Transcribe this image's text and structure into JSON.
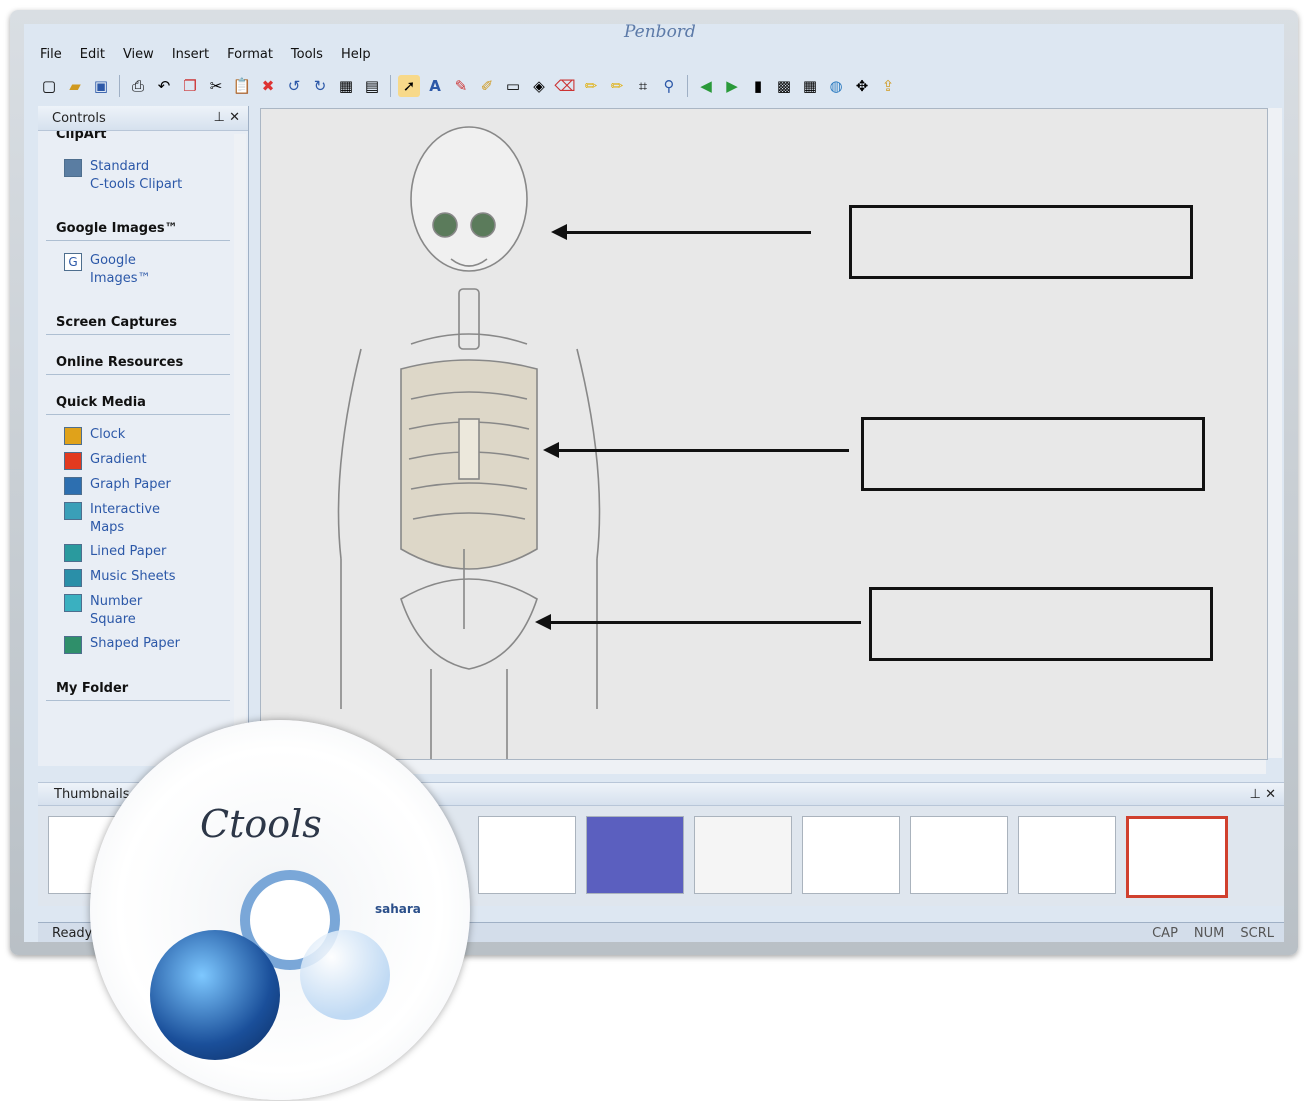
{
  "app": {
    "brand": "Penbord"
  },
  "menu": [
    "File",
    "Edit",
    "View",
    "Insert",
    "Format",
    "Tools",
    "Help"
  ],
  "toolbar_icons": [
    "new",
    "open",
    "save",
    "print",
    "undo-page",
    "copy",
    "cut",
    "paste",
    "delete",
    "undo",
    "redo",
    "image",
    "image2",
    "select",
    "text",
    "pen",
    "marker",
    "shape",
    "fill",
    "eraser",
    "highlighter",
    "highlighter2",
    "crop",
    "magic",
    "back",
    "forward",
    "screen",
    "camera",
    "calculator",
    "globe",
    "move",
    "share"
  ],
  "controls": {
    "title": "Controls",
    "cut_header": "ClipArt",
    "clipart": [
      "Standard",
      "C-tools Clipart"
    ],
    "google_header": "Google Images™",
    "google": [
      "Google",
      "Images™"
    ],
    "sections": [
      "Screen Captures",
      "Online Resources",
      "Quick Media"
    ],
    "quick_media": [
      {
        "label": "Clock",
        "color": "#e0a21a"
      },
      {
        "label": "Gradient",
        "color": "#e23a1f"
      },
      {
        "label": "Graph Paper",
        "color": "#2d6fb0"
      },
      {
        "label": "Interactive",
        "label2": "Maps",
        "color": "#3a9fb8"
      },
      {
        "label": "Lined Paper",
        "color": "#2a9a9e"
      },
      {
        "label": "Music Sheets",
        "color": "#2a8fa8"
      },
      {
        "label": "Number",
        "label2": "Square",
        "color": "#3ab0c0"
      },
      {
        "label": "Shaped Paper",
        "color": "#2f8f6a"
      }
    ],
    "my_folder": "My Folder"
  },
  "thumbnails": {
    "title": "Thumbnails"
  },
  "status": {
    "ready": "Ready",
    "cap": "CAP",
    "num": "NUM",
    "scrl": "SCRL"
  },
  "disc": {
    "title": "Ctools",
    "logo": "sahara"
  }
}
